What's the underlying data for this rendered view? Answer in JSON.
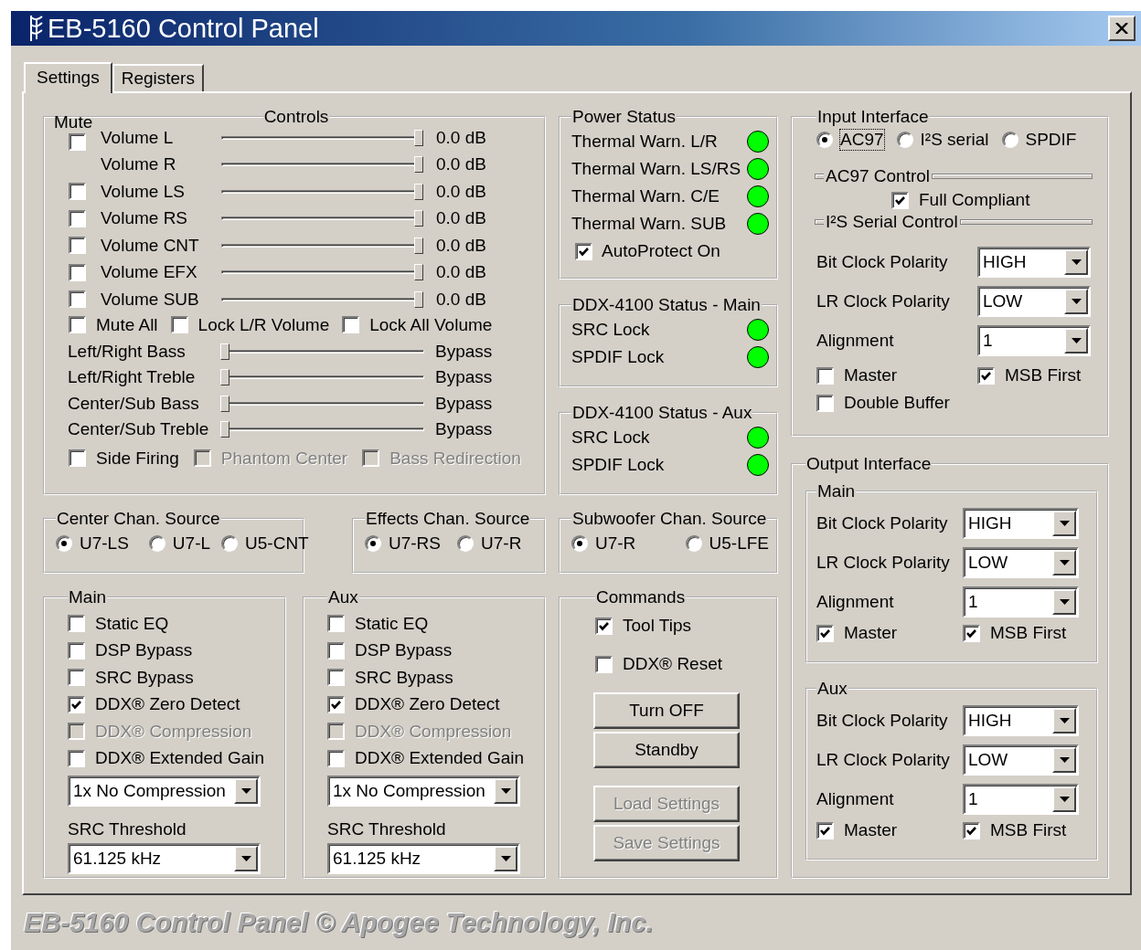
{
  "window": {
    "title": "EB-5160 Control Panel"
  },
  "tabs": [
    {
      "label": "Settings",
      "selected": true
    },
    {
      "label": "Registers",
      "selected": false
    }
  ],
  "controls": {
    "title": "Controls",
    "mute_header": "Mute",
    "volumes": [
      {
        "label": "Volume L",
        "kind": "paired",
        "mute_checked": false,
        "level": 1,
        "reading": "0.0 dB"
      },
      {
        "label": "Volume R",
        "kind": "follower",
        "level": 1,
        "reading": "0.0 dB"
      },
      {
        "label": "Volume LS",
        "kind": "single",
        "mute_checked": false,
        "level": 1,
        "reading": "0.0 dB"
      },
      {
        "label": "Volume RS",
        "kind": "single",
        "mute_checked": false,
        "level": 1,
        "reading": "0.0 dB"
      },
      {
        "label": "Volume CNT",
        "kind": "single",
        "mute_checked": false,
        "level": 1,
        "reading": "0.0 dB"
      },
      {
        "label": "Volume EFX",
        "kind": "single",
        "mute_checked": false,
        "level": 1,
        "reading": "0.0 dB"
      },
      {
        "label": "Volume SUB",
        "kind": "single",
        "mute_checked": false,
        "level": 1,
        "reading": "0.0 dB"
      }
    ],
    "options": [
      {
        "label": "Mute All",
        "checked": false
      },
      {
        "label": "Lock L/R Volume",
        "checked": false
      },
      {
        "label": "Lock All Volume",
        "checked": false
      }
    ],
    "tones": [
      {
        "label": "Left/Right Bass",
        "level": 0,
        "reading": "Bypass"
      },
      {
        "label": "Left/Right Treble",
        "level": 0,
        "reading": "Bypass"
      },
      {
        "label": "Center/Sub Bass",
        "level": 0,
        "reading": "Bypass"
      },
      {
        "label": "Center/Sub Treble",
        "level": 0,
        "reading": "Bypass"
      }
    ],
    "flags": [
      {
        "label": "Side Firing",
        "checked": false,
        "disabled": false
      },
      {
        "label": "Phantom Center",
        "checked": false,
        "disabled": true
      },
      {
        "label": "Bass Redirection",
        "checked": false,
        "disabled": true
      }
    ]
  },
  "power_status": {
    "title": "Power Status",
    "indicators": [
      {
        "label": "Thermal Warn. L/R",
        "color": "#00ff00"
      },
      {
        "label": "Thermal Warn. LS/RS",
        "color": "#00ff00"
      },
      {
        "label": "Thermal Warn. C/E",
        "color": "#00ff00"
      },
      {
        "label": "Thermal Warn. SUB",
        "color": "#00ff00"
      }
    ],
    "autoprotect": {
      "label": "AutoProtect On",
      "checked": true
    }
  },
  "ddx_main_status": {
    "title": "DDX-4100 Status - Main",
    "indicators": [
      {
        "label": "SRC Lock",
        "color": "#00ff00"
      },
      {
        "label": "SPDIF Lock",
        "color": "#00ff00"
      }
    ]
  },
  "ddx_aux_status": {
    "title": "DDX-4100 Status - Aux",
    "indicators": [
      {
        "label": "SRC Lock",
        "color": "#00ff00"
      },
      {
        "label": "SPDIF Lock",
        "color": "#00ff00"
      }
    ]
  },
  "input_interface": {
    "title": "Input Interface",
    "options": [
      {
        "label": "AC97",
        "selected": true,
        "focused": true
      },
      {
        "label": "I²S serial",
        "selected": false,
        "focused": false
      },
      {
        "label": "SPDIF",
        "selected": false,
        "focused": false
      }
    ],
    "ac97_control": {
      "title": "AC97 Control",
      "full_compliant": {
        "label": "Full Compliant",
        "checked": true
      }
    },
    "i2s_control": {
      "title": "I²S Serial Control",
      "fields": [
        {
          "label": "Bit Clock Polarity",
          "value": "HIGH"
        },
        {
          "label": "LR Clock Polarity",
          "value": "LOW"
        },
        {
          "label": "Alignment",
          "value": "1"
        }
      ],
      "checks": [
        {
          "label": "Master",
          "checked": false
        },
        {
          "label": "MSB First",
          "checked": true
        },
        {
          "label": "Double Buffer",
          "checked": false
        }
      ]
    }
  },
  "sources": [
    {
      "title": "Center Chan. Source",
      "options": [
        {
          "label": "U7-LS",
          "selected": true
        },
        {
          "label": "U7-L",
          "selected": false
        },
        {
          "label": "U5-CNT",
          "selected": false
        }
      ]
    },
    {
      "title": "Effects Chan. Source",
      "options": [
        {
          "label": "U7-RS",
          "selected": true
        },
        {
          "label": "U7-R",
          "selected": false
        }
      ]
    },
    {
      "title": "Subwoofer Chan. Source",
      "options": [
        {
          "label": "U7-R",
          "selected": true
        },
        {
          "label": "U5-LFE",
          "selected": false
        }
      ]
    }
  ],
  "dsp_groups": [
    {
      "title": "Main",
      "checks": [
        {
          "label": "Static EQ",
          "checked": false,
          "disabled": false
        },
        {
          "label": "DSP Bypass",
          "checked": false,
          "disabled": false
        },
        {
          "label": "SRC Bypass",
          "checked": false,
          "disabled": false
        },
        {
          "label": "DDX® Zero Detect",
          "checked": true,
          "disabled": false
        },
        {
          "label": "DDX® Compression",
          "checked": false,
          "disabled": true
        },
        {
          "label": "DDX® Extended Gain",
          "checked": false,
          "disabled": false
        }
      ],
      "compression": "1x No Compression",
      "threshold_label": "SRC Threshold",
      "threshold": "61.125 kHz"
    },
    {
      "title": "Aux",
      "checks": [
        {
          "label": "Static EQ",
          "checked": false,
          "disabled": false
        },
        {
          "label": "DSP Bypass",
          "checked": false,
          "disabled": false
        },
        {
          "label": "SRC Bypass",
          "checked": false,
          "disabled": false
        },
        {
          "label": "DDX® Zero Detect",
          "checked": true,
          "disabled": false
        },
        {
          "label": "DDX® Compression",
          "checked": false,
          "disabled": true
        },
        {
          "label": "DDX® Extended Gain",
          "checked": false,
          "disabled": false
        }
      ],
      "compression": "1x No Compression",
      "threshold_label": "SRC Threshold",
      "threshold": "61.125 kHz"
    }
  ],
  "commands": {
    "title": "Commands",
    "checks": [
      {
        "label": "Tool Tips",
        "checked": true
      },
      {
        "label": "DDX® Reset",
        "checked": false
      }
    ],
    "buttons": [
      {
        "label": "Turn OFF",
        "disabled": false,
        "kind": "power"
      },
      {
        "label": "Standby",
        "disabled": false,
        "kind": "power"
      },
      {
        "label": "Load Settings",
        "disabled": true,
        "kind": "file"
      },
      {
        "label": "Save Settings",
        "disabled": true,
        "kind": "file"
      }
    ]
  },
  "output_interface": {
    "title": "Output Interface",
    "groups": [
      {
        "title": "Main",
        "fields": [
          {
            "label": "Bit Clock Polarity",
            "value": "HIGH"
          },
          {
            "label": "LR Clock Polarity",
            "value": "LOW"
          },
          {
            "label": "Alignment",
            "value": "1"
          }
        ],
        "checks": [
          {
            "label": "Master",
            "checked": true
          },
          {
            "label": "MSB First",
            "checked": true
          }
        ]
      },
      {
        "title": "Aux",
        "fields": [
          {
            "label": "Bit Clock Polarity",
            "value": "HIGH"
          },
          {
            "label": "LR Clock Polarity",
            "value": "LOW"
          },
          {
            "label": "Alignment",
            "value": "1"
          }
        ],
        "checks": [
          {
            "label": "Master",
            "checked": true
          },
          {
            "label": "MSB First",
            "checked": true
          }
        ]
      }
    ]
  },
  "footer": "EB-5160 Control Panel © Apogee Technology, Inc."
}
